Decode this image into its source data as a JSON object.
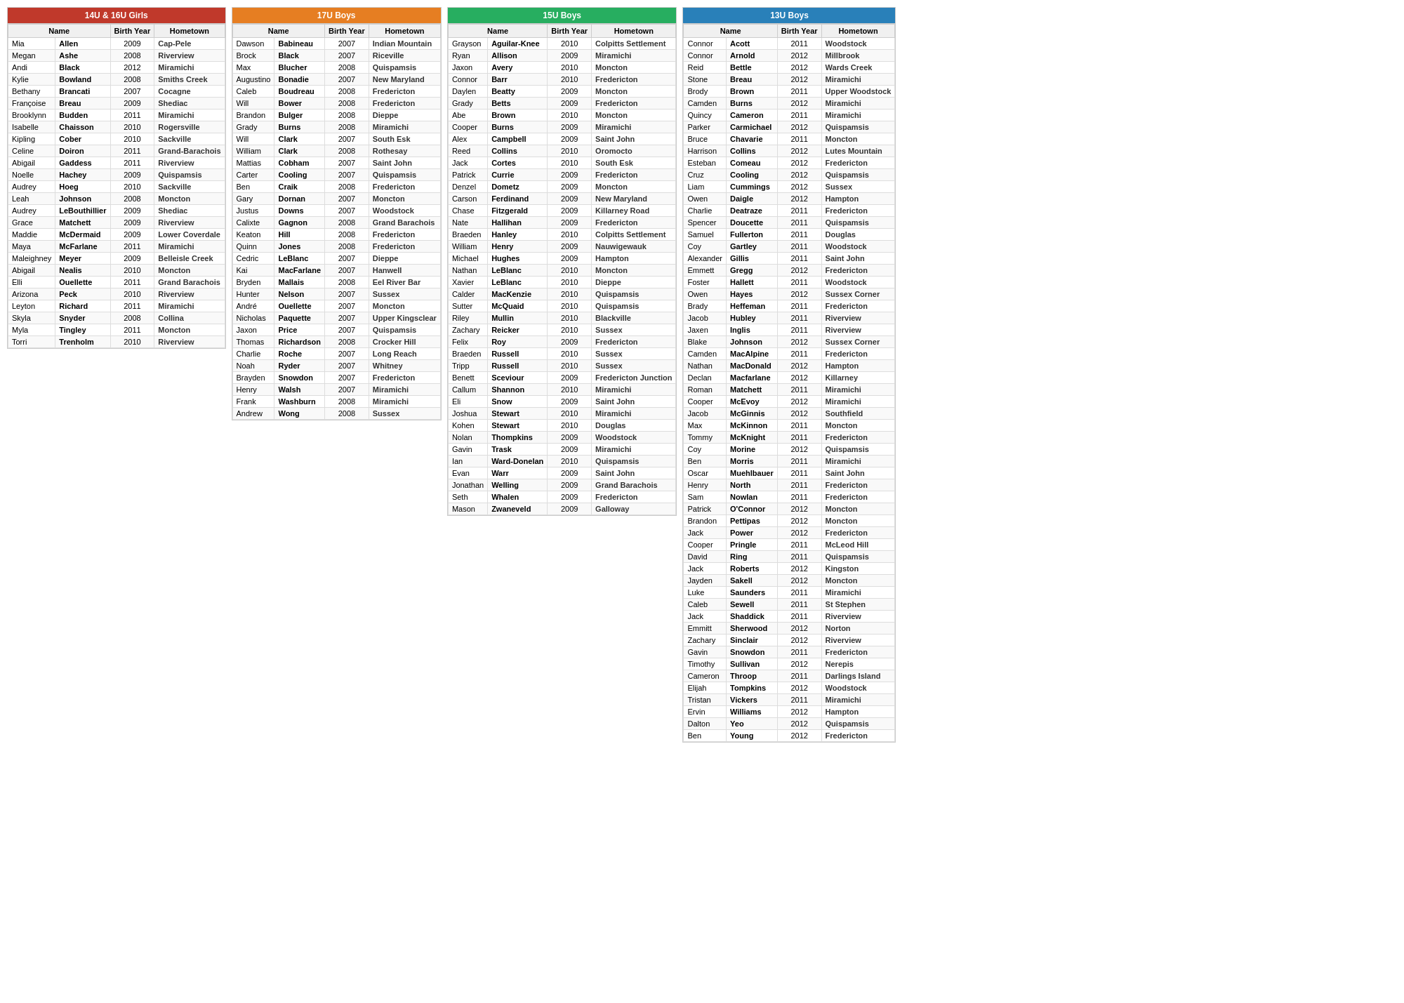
{
  "sections": [
    {
      "id": "girls14u16u",
      "title": "14U & 16U Girls",
      "titleClass": "girls-title",
      "columns": [
        "Name",
        "Birth Year",
        "Hometown"
      ],
      "rows": [
        [
          "Mia",
          "Allen",
          "2009",
          "Cap-Pele"
        ],
        [
          "Megan",
          "Ashe",
          "2008",
          "Riverview"
        ],
        [
          "Andi",
          "Black",
          "2012",
          "Miramichi"
        ],
        [
          "Kylie",
          "Bowland",
          "2008",
          "Smiths Creek"
        ],
        [
          "Bethany",
          "Brancati",
          "2007",
          "Cocagne"
        ],
        [
          "Françoise",
          "Breau",
          "2009",
          "Shediac"
        ],
        [
          "Brooklynn",
          "Budden",
          "2011",
          "Miramichi"
        ],
        [
          "Isabelle",
          "Chaisson",
          "2010",
          "Rogersville"
        ],
        [
          "Kipling",
          "Cober",
          "2010",
          "Sackville"
        ],
        [
          "Celine",
          "Doiron",
          "2011",
          "Grand-Barachois"
        ],
        [
          "Abigail",
          "Gaddess",
          "2011",
          "Riverview"
        ],
        [
          "Noelle",
          "Hachey",
          "2009",
          "Quispamsis"
        ],
        [
          "Audrey",
          "Hoeg",
          "2010",
          "Sackville"
        ],
        [
          "Leah",
          "Johnson",
          "2008",
          "Moncton"
        ],
        [
          "Audrey",
          "LeBouthillier",
          "2009",
          "Shediac"
        ],
        [
          "Grace",
          "Matchett",
          "2009",
          "Riverview"
        ],
        [
          "Maddie",
          "McDermaid",
          "2009",
          "Lower Coverdale"
        ],
        [
          "Maya",
          "McFarlane",
          "2011",
          "Miramichi"
        ],
        [
          "Maleighney",
          "Meyer",
          "2009",
          "Belleisle Creek"
        ],
        [
          "Abigail",
          "Nealis",
          "2010",
          "Moncton"
        ],
        [
          "Elli",
          "Ouellette",
          "2011",
          "Grand Barachois"
        ],
        [
          "Arizona",
          "Peck",
          "2010",
          "Riverview"
        ],
        [
          "Leyton",
          "Richard",
          "2011",
          "Miramichi"
        ],
        [
          "Skyla",
          "Snyder",
          "2008",
          "Collina"
        ],
        [
          "Myla",
          "Tingley",
          "2011",
          "Moncton"
        ],
        [
          "Torri",
          "Trenholm",
          "2010",
          "Riverview"
        ]
      ]
    },
    {
      "id": "boys17u",
      "title": "17U Boys",
      "titleClass": "boys17-title",
      "columns": [
        "Name",
        "Birth Year",
        "Hometown"
      ],
      "rows": [
        [
          "Dawson",
          "Babineau",
          "2007",
          "Indian Mountain"
        ],
        [
          "Brock",
          "Black",
          "2007",
          "Riceville"
        ],
        [
          "Max",
          "Blucher",
          "2008",
          "Quispamsis"
        ],
        [
          "Augustino",
          "Bonadie",
          "2007",
          "New Maryland"
        ],
        [
          "Caleb",
          "Boudreau",
          "2008",
          "Fredericton"
        ],
        [
          "Will",
          "Bower",
          "2008",
          "Fredericton"
        ],
        [
          "Brandon",
          "Bulger",
          "2008",
          "Dieppe"
        ],
        [
          "Grady",
          "Burns",
          "2008",
          "Miramichi"
        ],
        [
          "Will",
          "Clark",
          "2007",
          "South Esk"
        ],
        [
          "William",
          "Clark",
          "2008",
          "Rothesay"
        ],
        [
          "Mattias",
          "Cobham",
          "2007",
          "Saint John"
        ],
        [
          "Carter",
          "Cooling",
          "2007",
          "Quispamsis"
        ],
        [
          "Ben",
          "Craik",
          "2008",
          "Fredericton"
        ],
        [
          "Gary",
          "Dornan",
          "2007",
          "Moncton"
        ],
        [
          "Justus",
          "Downs",
          "2007",
          "Woodstock"
        ],
        [
          "Calixte",
          "Gagnon",
          "2008",
          "Grand Barachois"
        ],
        [
          "Keaton",
          "Hill",
          "2008",
          "Fredericton"
        ],
        [
          "Quinn",
          "Jones",
          "2008",
          "Fredericton"
        ],
        [
          "Cedric",
          "LeBlanc",
          "2007",
          "Dieppe"
        ],
        [
          "Kai",
          "MacFarlane",
          "2007",
          "Hanwell"
        ],
        [
          "Bryden",
          "Mallais",
          "2008",
          "Eel River Bar"
        ],
        [
          "Hunter",
          "Nelson",
          "2007",
          "Sussex"
        ],
        [
          "André",
          "Ouellette",
          "2007",
          "Moncton"
        ],
        [
          "Nicholas",
          "Paquette",
          "2007",
          "Upper Kingsclear"
        ],
        [
          "Jaxon",
          "Price",
          "2007",
          "Quispamsis"
        ],
        [
          "Thomas",
          "Richardson",
          "2008",
          "Crocker Hill"
        ],
        [
          "Charlie",
          "Roche",
          "2007",
          "Long Reach"
        ],
        [
          "Noah",
          "Ryder",
          "2007",
          "Whitney"
        ],
        [
          "Brayden",
          "Snowdon",
          "2007",
          "Fredericton"
        ],
        [
          "Henry",
          "Walsh",
          "2007",
          "Miramichi"
        ],
        [
          "Frank",
          "Washburn",
          "2008",
          "Miramichi"
        ],
        [
          "Andrew",
          "Wong",
          "2008",
          "Sussex"
        ]
      ]
    },
    {
      "id": "boys15u",
      "title": "15U Boys",
      "titleClass": "boys15-title",
      "columns": [
        "Name",
        "Birth Year",
        "Hometown"
      ],
      "rows": [
        [
          "Grayson",
          "Aguilar-Knee",
          "2010",
          "Colpitts Settlement"
        ],
        [
          "Ryan",
          "Allison",
          "2009",
          "Miramichi"
        ],
        [
          "Jaxon",
          "Avery",
          "2010",
          "Moncton"
        ],
        [
          "Connor",
          "Barr",
          "2010",
          "Fredericton"
        ],
        [
          "Daylen",
          "Beatty",
          "2009",
          "Moncton"
        ],
        [
          "Grady",
          "Betts",
          "2009",
          "Fredericton"
        ],
        [
          "Abe",
          "Brown",
          "2010",
          "Moncton"
        ],
        [
          "Cooper",
          "Burns",
          "2009",
          "Miramichi"
        ],
        [
          "Alex",
          "Campbell",
          "2009",
          "Saint John"
        ],
        [
          "Reed",
          "Collins",
          "2010",
          "Oromocto"
        ],
        [
          "Jack",
          "Cortes",
          "2010",
          "South Esk"
        ],
        [
          "Patrick",
          "Currie",
          "2009",
          "Fredericton"
        ],
        [
          "Denzel",
          "Dometz",
          "2009",
          "Moncton"
        ],
        [
          "Carson",
          "Ferdinand",
          "2009",
          "New Maryland"
        ],
        [
          "Chase",
          "Fitzgerald",
          "2009",
          "Killarney Road"
        ],
        [
          "Nate",
          "Hallihan",
          "2009",
          "Fredericton"
        ],
        [
          "Braeden",
          "Hanley",
          "2010",
          "Colpitts Settlement"
        ],
        [
          "William",
          "Henry",
          "2009",
          "Nauwigewauk"
        ],
        [
          "Michael",
          "Hughes",
          "2009",
          "Hampton"
        ],
        [
          "Nathan",
          "LeBlanc",
          "2010",
          "Moncton"
        ],
        [
          "Xavier",
          "LeBlanc",
          "2010",
          "Dieppe"
        ],
        [
          "Calder",
          "MacKenzie",
          "2010",
          "Quispamsis"
        ],
        [
          "Sutter",
          "McQuaid",
          "2010",
          "Quispamsis"
        ],
        [
          "Riley",
          "Mullin",
          "2010",
          "Blackville"
        ],
        [
          "Zachary",
          "Reicker",
          "2010",
          "Sussex"
        ],
        [
          "Felix",
          "Roy",
          "2009",
          "Fredericton"
        ],
        [
          "Braeden",
          "Russell",
          "2010",
          "Sussex"
        ],
        [
          "Tripp",
          "Russell",
          "2010",
          "Sussex"
        ],
        [
          "Benett",
          "Sceviour",
          "2009",
          "Fredericton Junction"
        ],
        [
          "Callum",
          "Shannon",
          "2010",
          "Miramichi"
        ],
        [
          "Eli",
          "Snow",
          "2009",
          "Saint John"
        ],
        [
          "Joshua",
          "Stewart",
          "2010",
          "Miramichi"
        ],
        [
          "Kohen",
          "Stewart",
          "2010",
          "Douglas"
        ],
        [
          "Nolan",
          "Thompkins",
          "2009",
          "Woodstock"
        ],
        [
          "Gavin",
          "Trask",
          "2009",
          "Miramichi"
        ],
        [
          "Ian",
          "Ward-Donelan",
          "2010",
          "Quispamsis"
        ],
        [
          "Evan",
          "Warr",
          "2009",
          "Saint John"
        ],
        [
          "Jonathan",
          "Welling",
          "2009",
          "Grand Barachois"
        ],
        [
          "Seth",
          "Whalen",
          "2009",
          "Fredericton"
        ],
        [
          "Mason",
          "Zwaneveld",
          "2009",
          "Galloway"
        ]
      ]
    },
    {
      "id": "boys13u",
      "title": "13U Boys",
      "titleClass": "boys13-title",
      "columns": [
        "Name",
        "Birth Year",
        "Hometown"
      ],
      "rows": [
        [
          "Connor",
          "Acott",
          "2011",
          "Woodstock"
        ],
        [
          "Connor",
          "Arnold",
          "2012",
          "Millbrook"
        ],
        [
          "Reid",
          "Bettle",
          "2012",
          "Wards Creek"
        ],
        [
          "Stone",
          "Breau",
          "2012",
          "Miramichi"
        ],
        [
          "Brody",
          "Brown",
          "2011",
          "Upper Woodstock"
        ],
        [
          "Camden",
          "Burns",
          "2012",
          "Miramichi"
        ],
        [
          "Quincy",
          "Cameron",
          "2011",
          "Miramichi"
        ],
        [
          "Parker",
          "Carmichael",
          "2012",
          "Quispamsis"
        ],
        [
          "Bruce",
          "Chavarie",
          "2011",
          "Moncton"
        ],
        [
          "Harrison",
          "Collins",
          "2012",
          "Lutes Mountain"
        ],
        [
          "Esteban",
          "Comeau",
          "2012",
          "Fredericton"
        ],
        [
          "Cruz",
          "Cooling",
          "2012",
          "Quispamsis"
        ],
        [
          "Liam",
          "Cummings",
          "2012",
          "Sussex"
        ],
        [
          "Owen",
          "Daigle",
          "2012",
          "Hampton"
        ],
        [
          "Charlie",
          "Deatraze",
          "2011",
          "Fredericton"
        ],
        [
          "Spencer",
          "Doucette",
          "2011",
          "Quispamsis"
        ],
        [
          "Samuel",
          "Fullerton",
          "2011",
          "Douglas"
        ],
        [
          "Coy",
          "Gartley",
          "2011",
          "Woodstock"
        ],
        [
          "Alexander",
          "Gillis",
          "2011",
          "Saint John"
        ],
        [
          "Emmett",
          "Gregg",
          "2012",
          "Fredericton"
        ],
        [
          "Foster",
          "Hallett",
          "2011",
          "Woodstock"
        ],
        [
          "Owen",
          "Hayes",
          "2012",
          "Sussex Corner"
        ],
        [
          "Brady",
          "Heffeman",
          "2011",
          "Fredericton"
        ],
        [
          "Jacob",
          "Hubley",
          "2011",
          "Riverview"
        ],
        [
          "Jaxen",
          "Inglis",
          "2011",
          "Riverview"
        ],
        [
          "Blake",
          "Johnson",
          "2012",
          "Sussex Corner"
        ],
        [
          "Camden",
          "MacAlpine",
          "2011",
          "Fredericton"
        ],
        [
          "Nathan",
          "MacDonald",
          "2012",
          "Hampton"
        ],
        [
          "Declan",
          "Macfarlane",
          "2012",
          "Killarney"
        ],
        [
          "Roman",
          "Matchett",
          "2011",
          "Miramichi"
        ],
        [
          "Cooper",
          "McEvoy",
          "2012",
          "Miramichi"
        ],
        [
          "Jacob",
          "McGinnis",
          "2012",
          "Southfield"
        ],
        [
          "Max",
          "McKinnon",
          "2011",
          "Moncton"
        ],
        [
          "Tommy",
          "McKnight",
          "2011",
          "Fredericton"
        ],
        [
          "Coy",
          "Morine",
          "2012",
          "Quispamsis"
        ],
        [
          "Ben",
          "Morris",
          "2011",
          "Miramichi"
        ],
        [
          "Oscar",
          "Muehlbauer",
          "2011",
          "Saint John"
        ],
        [
          "Henry",
          "North",
          "2011",
          "Fredericton"
        ],
        [
          "Sam",
          "Nowlan",
          "2011",
          "Fredericton"
        ],
        [
          "Patrick",
          "O'Connor",
          "2012",
          "Moncton"
        ],
        [
          "Brandon",
          "Pettipas",
          "2012",
          "Moncton"
        ],
        [
          "Jack",
          "Power",
          "2012",
          "Fredericton"
        ],
        [
          "Cooper",
          "Pringle",
          "2011",
          "McLeod Hill"
        ],
        [
          "David",
          "Ring",
          "2011",
          "Quispamsis"
        ],
        [
          "Jack",
          "Roberts",
          "2012",
          "Kingston"
        ],
        [
          "Jayden",
          "Sakell",
          "2012",
          "Moncton"
        ],
        [
          "Luke",
          "Saunders",
          "2011",
          "Miramichi"
        ],
        [
          "Caleb",
          "Sewell",
          "2011",
          "St Stephen"
        ],
        [
          "Jack",
          "Shaddick",
          "2011",
          "Riverview"
        ],
        [
          "Emmitt",
          "Sherwood",
          "2012",
          "Norton"
        ],
        [
          "Zachary",
          "Sinclair",
          "2012",
          "Riverview"
        ],
        [
          "Gavin",
          "Snowdon",
          "2011",
          "Fredericton"
        ],
        [
          "Timothy",
          "Sullivan",
          "2012",
          "Nerepis"
        ],
        [
          "Cameron",
          "Throop",
          "2011",
          "Darlings Island"
        ],
        [
          "Elijah",
          "Tompkins",
          "2012",
          "Woodstock"
        ],
        [
          "Tristan",
          "Vickers",
          "2011",
          "Miramichi"
        ],
        [
          "Ervin",
          "Williams",
          "2012",
          "Hampton"
        ],
        [
          "Dalton",
          "Yeo",
          "2012",
          "Quispamsis"
        ],
        [
          "Ben",
          "Young",
          "2012",
          "Fredericton"
        ]
      ]
    }
  ]
}
